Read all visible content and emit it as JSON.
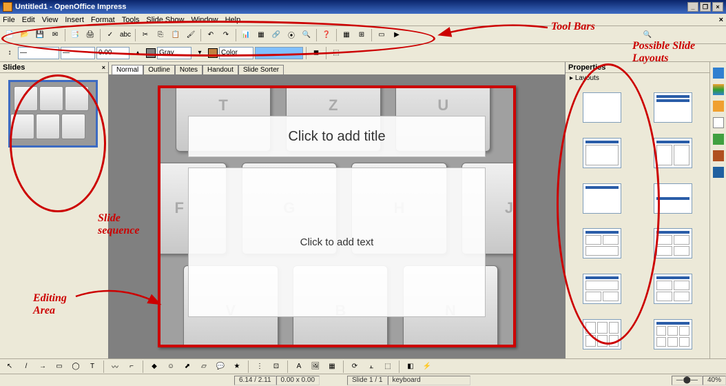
{
  "window": {
    "title": "Untitled1 - OpenOffice Impress"
  },
  "menus": [
    "File",
    "Edit",
    "View",
    "Insert",
    "Format",
    "Tools",
    "Slide Show",
    "Window",
    "Help"
  ],
  "toolbar2": {
    "fontsize": "0.00",
    "colorLabel1": "Gray",
    "colorLabel2": "Color"
  },
  "panels": {
    "slides": "Slides",
    "properties": "Properties",
    "layouts": "Layouts"
  },
  "viewtabs": [
    "Normal",
    "Outline",
    "Notes",
    "Handout",
    "Slide Sorter"
  ],
  "placeholders": {
    "title": "Click to add title",
    "text": "Click to add text"
  },
  "keyboard": {
    "row1": [
      "T",
      "Z",
      "U"
    ],
    "row2": [
      "F",
      "G",
      "H",
      "J"
    ],
    "row3": [
      "V",
      "B",
      "N"
    ]
  },
  "status": {
    "pos": "6.14 / 2.11",
    "size": "0.00 x 0.00",
    "slide": "Slide 1 / 1",
    "layout": "keyboard",
    "zoom": "40%"
  },
  "annotations": {
    "toolbars": "Tool Bars",
    "layouts": "Possible Slide Layouts",
    "sequence": "Slide sequence",
    "editing": "Editing Area"
  }
}
